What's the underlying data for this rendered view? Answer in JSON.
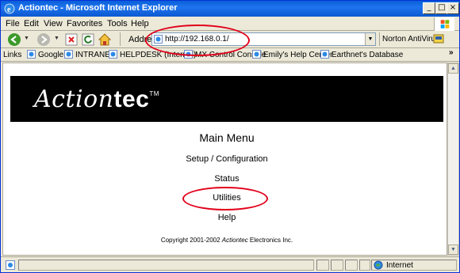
{
  "window": {
    "title": "Actiontec - Microsoft Internet Explorer",
    "btn_min": "_",
    "btn_max": "□",
    "btn_close": "×"
  },
  "menubar": {
    "items": [
      "File",
      "Edit",
      "View",
      "Favorites",
      "Tools",
      "Help"
    ]
  },
  "toolbar": {
    "address_label": "Address",
    "address_value": "http://192.168.0.1/",
    "norton_label": "Norton AntiVirus"
  },
  "links": {
    "label": "Links",
    "items": [
      "Google",
      "INTRANET",
      "HELPDESK (Internal)",
      "MX Control Console",
      "Emily's Help Center",
      "Earthnet's Database"
    ]
  },
  "page": {
    "logo_light": "Action",
    "logo_bold": "tec",
    "logo_tm": "TM",
    "menu_title": "Main Menu",
    "menu_links": [
      "Setup / Configuration",
      "Status",
      "Utilities",
      "Help"
    ],
    "copyright_prefix": "Copyright 2001-2002 ",
    "copyright_brand": "Actiontec",
    "copyright_suffix": " Electronics Inc."
  },
  "statusbar": {
    "zone": "Internet"
  },
  "colors": {
    "titlebar": "#0a5fd8",
    "highlight_ring": "#e2001a",
    "banner": "#000000"
  },
  "icons": [
    "ie-icon",
    "back-icon",
    "forward-icon",
    "stop-icon",
    "refresh-icon",
    "home-icon",
    "norton-icon",
    "globe-icon"
  ]
}
